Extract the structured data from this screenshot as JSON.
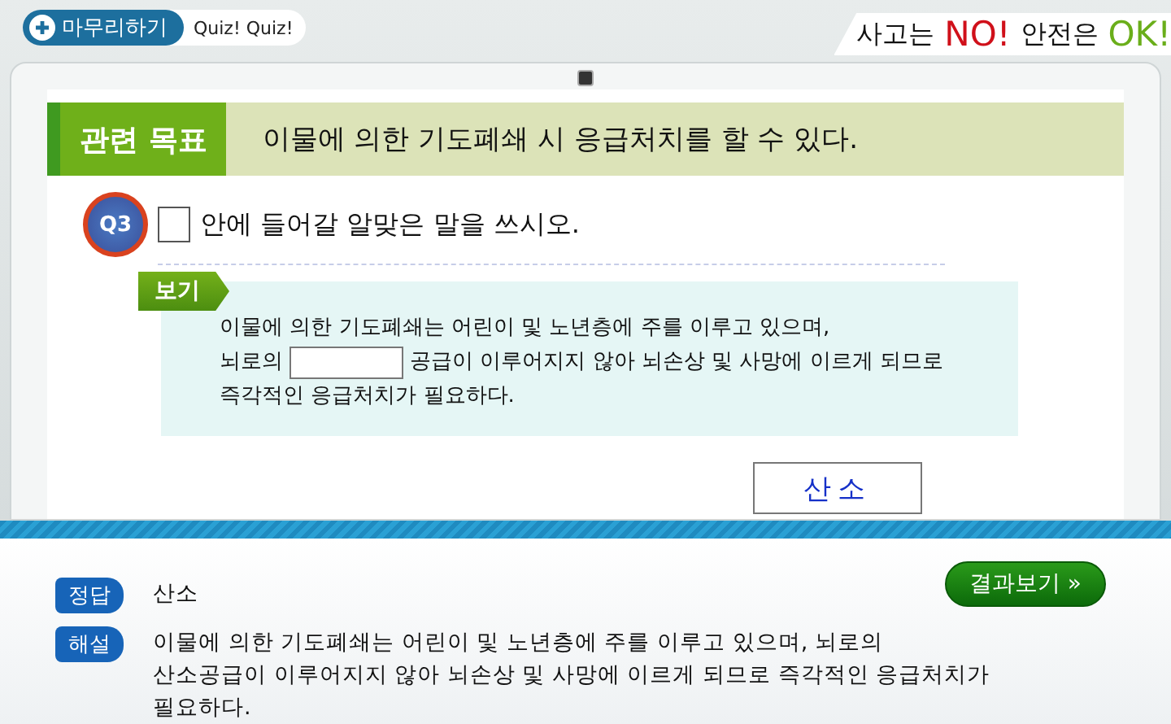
{
  "top_bar": {
    "finish_button": "마무리하기",
    "quiz_label": "Quiz! Quiz!",
    "slogan": [
      {
        "text": "사고는",
        "kind": "plain"
      },
      {
        "text": "NO!",
        "kind": "no"
      },
      {
        "text": "안전은",
        "kind": "plain"
      },
      {
        "text": "OK!",
        "kind": "ok"
      }
    ]
  },
  "goal": {
    "label": "관련 목표",
    "text": "이물에 의한 기도폐쇄 시 응급처치를 할 수 있다."
  },
  "question": {
    "badge": "Q3",
    "text": "안에 들어갈 알맞은 말을 쓰시오."
  },
  "example": {
    "label": "보기",
    "line_1": "이물에 의한 기도폐쇄는 어린이 및 노년층에 주를 이루고 있으며,",
    "line_2_before": "뇌로의",
    "line_2_after": "공급이 이루어지지 않아 뇌손상 및 사망에 이르게 되므로",
    "line_3": "즉각적인 응급처치가 필요하다."
  },
  "answer_field": {
    "value": "산소"
  },
  "result_button": "결과보기 »",
  "feedback": [
    {
      "label": "정답",
      "text": "산소"
    },
    {
      "label": "해설",
      "text": "이물에 의한 기도폐쇄는 어린이 및 노년층에 주를 이루고 있으며, 뇌로의 산소공급이 이루어지지 않아 뇌손상 및 사망에 이르게 되므로 즉각적인 응급처치가 필요하다."
    }
  ]
}
